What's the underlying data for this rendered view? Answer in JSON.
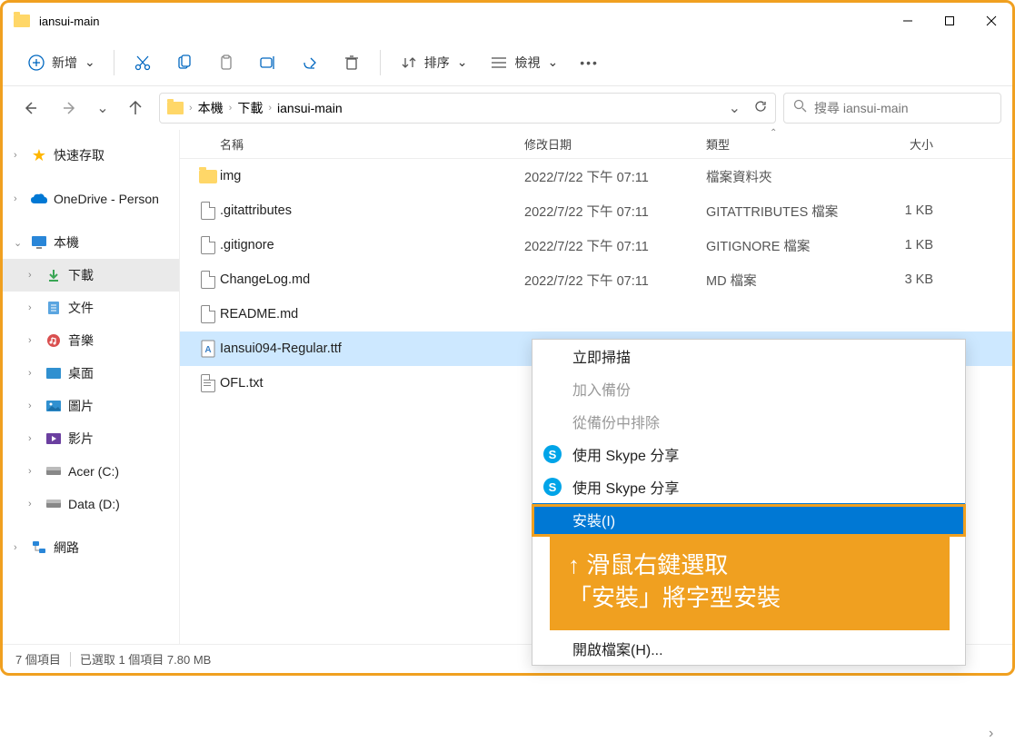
{
  "window": {
    "title": "iansui-main"
  },
  "toolbar": {
    "new": "新增",
    "sort": "排序",
    "view": "檢視"
  },
  "breadcrumb": [
    "本機",
    "下載",
    "iansui-main"
  ],
  "search": {
    "placeholder": "搜尋 iansui-main"
  },
  "sidebar": {
    "quick": "快速存取",
    "onedrive": "OneDrive - Person",
    "thispc": "本機",
    "downloads": "下載",
    "documents": "文件",
    "music": "音樂",
    "desktop": "桌面",
    "pictures": "圖片",
    "videos": "影片",
    "acer": "Acer (C:)",
    "data": "Data (D:)",
    "network": "網路"
  },
  "headers": {
    "name": "名稱",
    "date": "修改日期",
    "type": "類型",
    "size": "大小"
  },
  "files": [
    {
      "name": "img",
      "date": "2022/7/22 下午 07:11",
      "type": "檔案資料夾",
      "size": "",
      "icon": "folder"
    },
    {
      "name": ".gitattributes",
      "date": "2022/7/22 下午 07:11",
      "type": "GITATTRIBUTES 檔案",
      "size": "1 KB",
      "icon": "file"
    },
    {
      "name": ".gitignore",
      "date": "2022/7/22 下午 07:11",
      "type": "GITIGNORE 檔案",
      "size": "1 KB",
      "icon": "file"
    },
    {
      "name": "ChangeLog.md",
      "date": "2022/7/22 下午 07:11",
      "type": "MD 檔案",
      "size": "3 KB",
      "icon": "file"
    },
    {
      "name": "README.md",
      "date": "",
      "type": "",
      "size": "",
      "icon": "file"
    },
    {
      "name": "Iansui094-Regular.ttf",
      "date": "",
      "type": "",
      "size": "",
      "icon": "font",
      "selected": true
    },
    {
      "name": "OFL.txt",
      "date": "",
      "type": "",
      "size": "",
      "icon": "file"
    }
  ],
  "context_menu": {
    "scan": "立即掃描",
    "backup": "加入備份",
    "exclude": "從備份中排除",
    "skype1": "使用 Skype 分享",
    "skype2": "使用 Skype 分享",
    "install": "安裝(I)",
    "open": "開啟檔案(H)..."
  },
  "annotation": {
    "line1": "↑ 滑鼠右鍵選取",
    "line2": "「安裝」將字型安裝"
  },
  "status": {
    "count": "7 個項目",
    "selected": "已選取 1 個項目 7.80 MB"
  }
}
